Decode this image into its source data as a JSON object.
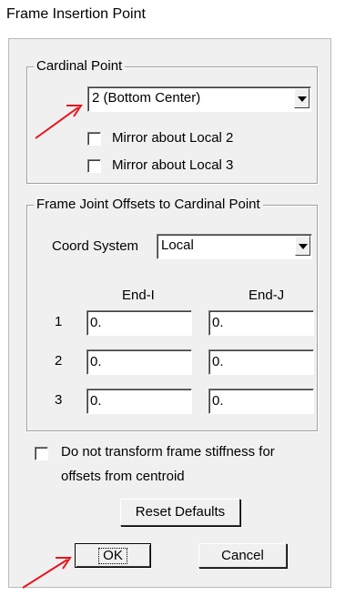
{
  "window": {
    "title": "Frame Insertion Point"
  },
  "cardinal": {
    "legend": "Cardinal Point",
    "selected": "2 (Bottom Center)",
    "mirror2_label": "Mirror about Local 2",
    "mirror3_label": "Mirror about Local 3",
    "mirror2_checked": false,
    "mirror3_checked": false
  },
  "offsets": {
    "legend": "Frame Joint Offsets to Cardinal Point",
    "coord_label": "Coord System",
    "coord_value": "Local",
    "col_end_i": "End-I",
    "col_end_j": "End-J",
    "rows": [
      {
        "label": "1",
        "end_i": "0.",
        "end_j": "0."
      },
      {
        "label": "2",
        "end_i": "0.",
        "end_j": "0."
      },
      {
        "label": "3",
        "end_i": "0.",
        "end_j": "0."
      }
    ]
  },
  "stiffness": {
    "line1": "Do not transform frame stiffness for",
    "line2": "offsets from centroid",
    "checked": false
  },
  "buttons": {
    "reset": "Reset Defaults",
    "ok": "OK",
    "cancel": "Cancel"
  },
  "annotation_color": "#e8141c"
}
